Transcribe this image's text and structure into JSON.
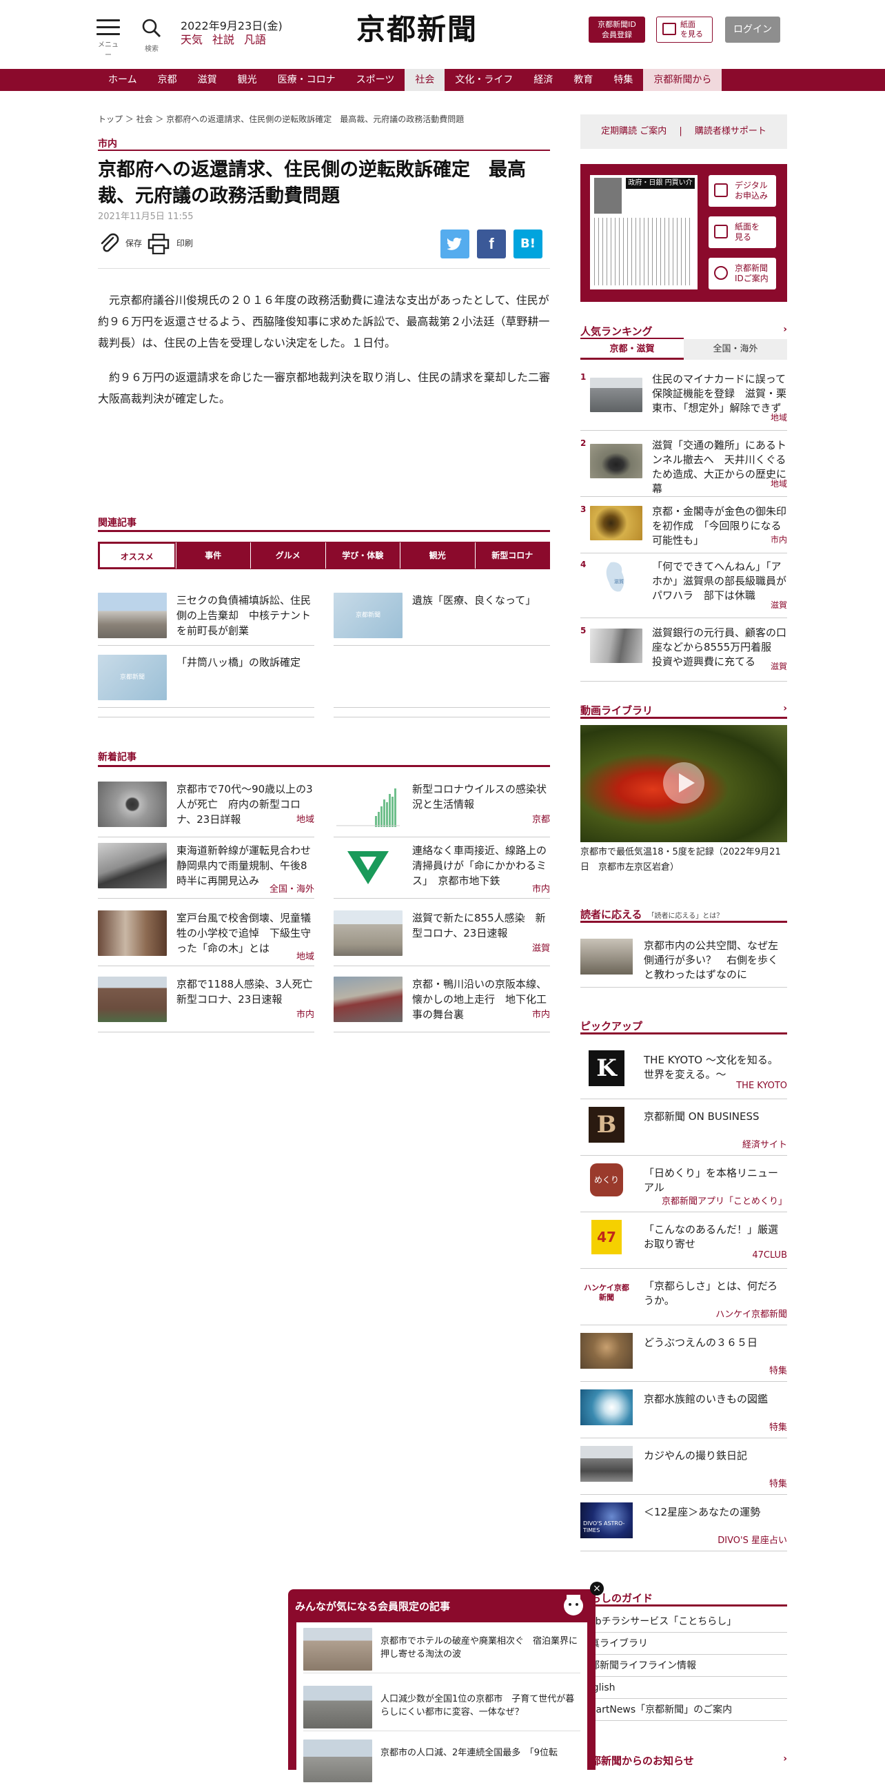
{
  "header": {
    "menu_label": "メニュー",
    "search_label": "検索",
    "date": "2022年9月23日(金)",
    "links": [
      "天気",
      "社説",
      "凡語"
    ],
    "logo_text": "京都新聞",
    "id_button": [
      "京都新聞ID",
      "会員登録"
    ],
    "paper_button": [
      "紙面",
      "を見る"
    ],
    "login_button": "ログイン"
  },
  "nav": [
    "ホーム",
    "京都",
    "滋賀",
    "観光",
    "医療・コロナ",
    "スポーツ",
    "社会",
    "文化・ライフ",
    "経済",
    "教育",
    "特集",
    "京都新聞から"
  ],
  "breadcrumb": "トップ ＞ 社会 ＞ 京都府への返還請求、住民側の逆転敗訴確定　最高裁、元府議の政務活動費問題",
  "article": {
    "category": "市内",
    "title": "京都府への返還請求、住民側の逆転敗訴確定　最高裁、元府議の政務活動費問題",
    "date": "2021年11月5日 11:55",
    "save_label": "保存",
    "print_label": "印刷",
    "paragraphs": [
      "元京都府議谷川俊規氏の２０１６年度の政務活動費に違法な支出があったとして、住民が約９６万円を返還させるよう、西脇隆俊知事に求めた訴訟で、最高裁第２小法廷（草野耕一裁判長）は、住民の上告を受理しない決定をした。１日付。",
      "約９６万円の返還請求を命じた一審京都地裁判決を取り消し、住民の請求を棄却した二審大阪高裁判決が確定した。"
    ]
  },
  "related": {
    "heading": "関連記事",
    "tabs": [
      "オススメ",
      "事件",
      "グルメ",
      "学び・体験",
      "観光",
      "新型コロナ"
    ],
    "items": [
      {
        "text": "三セクの負債補填訴訟、住民側の上告棄却　中核テナントを前町長が創業"
      },
      {
        "text": "遺族「医療、良くなって」"
      },
      {
        "text": "「井筒八ッ橋」の敗訴確定"
      }
    ],
    "placeholder_logo": "京都新聞"
  },
  "latest": {
    "heading": "新着記事",
    "items": [
      {
        "text": "京都市で70代～90歳以上の3人が死亡　府内の新型コロナ、23日詳報",
        "tag": "地域"
      },
      {
        "text": "新型コロナウイルスの感染状況と生活情報",
        "tag": "京都"
      },
      {
        "text": "東海道新幹線が運転見合わせ　静岡県内で雨量規制、午後8時半に再開見込み",
        "tag": "全国・海外"
      },
      {
        "text": "連絡なく車両接近、線路上の清掃員けが「命にかかわるミス」　京都市地下鉄",
        "tag": "市内"
      },
      {
        "text": "室戸台風で校舎倒壊、児童犠牲の小学校で追悼　下級生守った「命の木」とは",
        "tag": "地域"
      },
      {
        "text": "滋賀で新たに855人感染　新型コロナ、23日速報",
        "tag": "滋賀"
      },
      {
        "text": "京都で1188人感染、3人死亡　新型コロナ、23日速報",
        "tag": "市内"
      },
      {
        "text": "京都・鴨川沿いの京阪本線、懐かしの地上走行　地下化工事の舞台裏",
        "tag": "市内"
      }
    ]
  },
  "sidebar": {
    "support": [
      "定期購読 ご案内",
      "|",
      "購読者様サポート"
    ],
    "paper_buttons": [
      [
        "デジタル",
        "お申込み"
      ],
      [
        "紙面を",
        "見る"
      ],
      [
        "京都新聞",
        "IDご案内"
      ]
    ],
    "paper_headline": "政府・日銀 円買い介入",
    "ranking": {
      "heading": "人気ランキング",
      "tabs": [
        "京都・滋賀",
        "全国・海外"
      ],
      "items": [
        {
          "num": "1",
          "text": "住民のマイナカードに誤って保険証機能を登録　滋賀・栗東市、「想定外」解除できず",
          "tag": "地域"
        },
        {
          "num": "2",
          "text": "滋賀「交通の難所」にあるトンネル撤去へ　天井川くぐるため造成、大正からの歴史に幕",
          "tag": "地域"
        },
        {
          "num": "3",
          "text": "京都・金閣寺が金色の御朱印を初作成　「今回限りになる可能性も」",
          "tag": "市内"
        },
        {
          "num": "4",
          "text": "「何でできてへんねん」「アホか」滋賀県の部長級職員がパワハラ　部下は休職",
          "tag": "滋賀"
        },
        {
          "num": "5",
          "text": "滋賀銀行の元行員、顧客の口座などから8555万円着服　投資や遊興費に充てる",
          "tag": "滋賀"
        }
      ],
      "map_label": "滋賀"
    },
    "video": {
      "heading": "動画ライブラリ",
      "caption": "京都市で最低気温18・5度を記録（2022年9月21日　京都市左京区岩倉）"
    },
    "readers": {
      "heading": "読者に応える",
      "sub": "「読者に応える」とは？",
      "text": "京都市内の公共空間、なぜ左側通行が多い？　右側を歩くと教わったはずなのに"
    },
    "pickup": {
      "heading": "ピックアップ",
      "items": [
        {
          "logo": "K",
          "text": "THE KYOTO ～文化を知る。世界を変える。～",
          "tag": "THE KYOTO"
        },
        {
          "logo": "B",
          "text": "京都新聞 ON BUSINESS",
          "tag": "経済サイト"
        },
        {
          "logo": "めくり",
          "text": "「日めくり」を本格リニューアル",
          "tag": "京都新聞アプリ「ことめくり」"
        },
        {
          "logo": "47",
          "text": "「こんなのあるんだ！」厳選お取り寄せ",
          "tag": "47CLUB"
        },
        {
          "logo": "ハンケイ京都新聞",
          "text": "「京都らしさ」とは、何だろうか。",
          "tag": "ハンケイ京都新聞"
        },
        {
          "logo": "",
          "text": "どうぶつえんの３６５日",
          "tag": "特集"
        },
        {
          "logo": "",
          "text": "京都水族館のいきもの図鑑",
          "tag": "特集"
        },
        {
          "logo": "",
          "text": "カジやんの撮り鉄日記",
          "tag": "特集"
        },
        {
          "logo": "DIVO'S ASTRO-TIMES",
          "text": "＜12星座＞あなたの運勢",
          "tag": "DIVO'S 星座占い"
        }
      ]
    },
    "guide": {
      "heading": "暮らしのガイド",
      "items": [
        "Webチラシサービス「ことちらし」",
        "写真ライブラリ",
        "京都新聞ライフライン情報",
        "English",
        "SmartNews「京都新聞」のご案内"
      ]
    },
    "notice_heading": "京都新聞からのお知らせ"
  },
  "popup": {
    "title": "みんなが気になる会員限定の記事",
    "items": [
      "京都市でホテルの破産や廃業相次ぐ　宿泊業界に押し寄せる淘汰の波",
      "人口減少数が全国1位の京都市　子育て世代が暮らしにくい都市に変容、一体なぜ？",
      "京都市の人口減、2年連続全国最多　「9位転"
    ],
    "close": "×"
  },
  "colors": {
    "brand": "#8b0a2c",
    "twitter": "#55acee",
    "facebook": "#3b5998",
    "hatena": "#00a4de"
  }
}
